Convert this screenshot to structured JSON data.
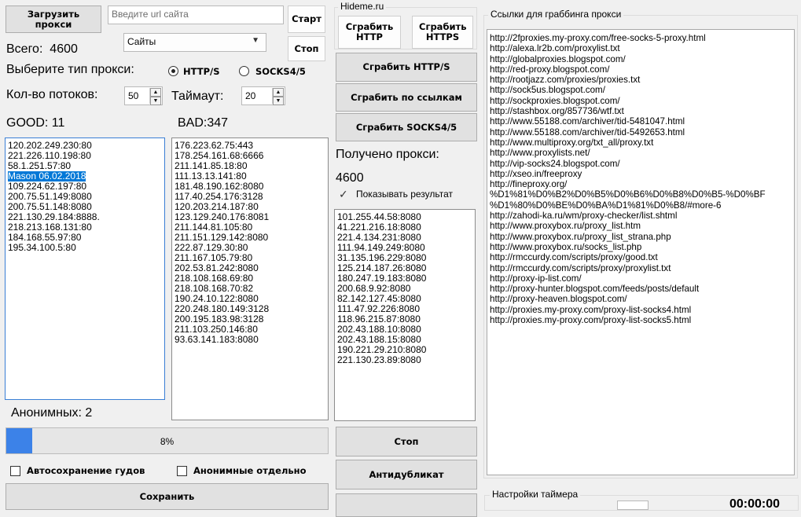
{
  "toolbar": {
    "load_proxy_label": "Загрузить прокси",
    "url_placeholder": "Введите url сайта",
    "start_label": "Старт",
    "stop_label": "Стоп",
    "source_select_value": "Сайты"
  },
  "stats": {
    "total_label": "Всего:",
    "total_value": "4600",
    "proxy_type_label": "Выберите тип прокси:",
    "type_http": "HTTP/S",
    "type_socks": "SOCKS4/5",
    "threads_label": "Кол-во потоков:",
    "threads_value": "50",
    "timeout_label": "Таймаут:",
    "timeout_value": "20"
  },
  "good": {
    "label": "GOOD: 11",
    "items": [
      "120.202.249.230:80",
      "221.226.110.198:80",
      "58.1.251.57:80",
      "Mason 06.02.2018",
      "109.224.62.197:80",
      "200.75.51.149:8080",
      "200.75.51.148:8080",
      "221.130.29.184:8888.",
      "218.213.168.131:80",
      "184.168.55.97:80",
      "195.34.100.5:80"
    ],
    "selected_index": 3
  },
  "bad": {
    "label": "BAD:347",
    "items": [
      "176.223.62.75:443",
      "178.254.161.68:6666",
      "211.141.85.18:80",
      "111.13.13.141:80",
      "181.48.190.162:8080",
      "117.40.254.176:3128",
      "120.203.214.187:80",
      "123.129.240.176:8081",
      "211.144.81.105:80",
      "211.151.129.142:8080",
      "222.87.129.30:80",
      "211.167.105.79:80",
      "202.53.81.242:8080",
      "218.108.168.69:80",
      "218.108.168.70:82",
      "190.24.10.122:8080",
      "220.248.180.149:3128",
      "200.195.183.98:3128",
      "211.103.250.146:80",
      "93.63.141.183:8080"
    ]
  },
  "anon": {
    "label": "Анонимных: 2"
  },
  "progress": {
    "value": 8,
    "text": "8%"
  },
  "options": {
    "autosave_label": "Автосохранение гудов",
    "anon_separate_label": "Анонимные отдельно",
    "save_label": "Сохранить"
  },
  "hideme": {
    "group_title": "Hideme.ru",
    "grab_http": "Сграбить HTTP",
    "grab_https": "Сграбить HTTPS"
  },
  "grab": {
    "grab_http_s": "Сграбить HTTP/S",
    "grab_by_links": "Сграбить по ссылкам",
    "grab_socks": "Сграбить SOCKS4/5",
    "received_label": "Получено прокси:",
    "received_value": "4600",
    "show_result_label": "Показывать результат",
    "show_result_checked": true,
    "results": [
      "101.255.44.58:8080",
      "41.221.216.18:8080",
      "221.4.134.231:8080",
      "111.94.149.249:8080",
      "31.135.196.229:8080",
      "125.214.187.26:8080",
      "180.247.19.183:8080",
      "200.68.9.92:8080",
      "82.142.127.45:8080",
      "111.47.92.226:8080",
      "118.96.215.87:8080",
      "202.43.188.10:8080",
      "202.43.188.15:8080",
      "190.221.29.210:8080",
      "221.130.23.89:8080"
    ],
    "stop_label": "Стоп",
    "antidup_label": "Антидубликат"
  },
  "links_panel": {
    "group_title": "Ссылки для граббинга прокси",
    "links": [
      "http://2fproxies.my-proxy.com/free-socks-5-proxy.html",
      "http://alexa.lr2b.com/proxylist.txt",
      "http://globalproxies.blogspot.com/",
      "http://red-proxy.blogspot.com/",
      "http://rootjazz.com/proxies/proxies.txt",
      "http://sock5us.blogspot.com/",
      "http://sockproxies.blogspot.com/",
      "http://stashbox.org/857736/wtf.txt",
      "http://www.55188.com/archiver/tid-5481047.html",
      "http://www.55188.com/archiver/tid-5492653.html",
      "http://www.multiproxy.org/txt_all/proxy.txt",
      "http://www.proxylists.net/",
      "http://vip-socks24.blogspot.com/",
      "http://xseo.in/freeproxy",
      "http://fineproxy.org/",
      "%D1%81%D0%B2%D0%B5%D0%B6%D0%B8%D0%B5-%D0%BF",
      "%D1%80%D0%BE%D0%BA%D1%81%D0%B8/#more-6",
      "http://zahodi-ka.ru/wm/proxy-checker/list.shtml",
      "http://www.proxybox.ru/proxy_list.htm",
      "http://www.proxybox.ru/proxy_list_strana.php",
      "http://www.proxybox.ru/socks_list.php",
      "http://rmccurdy.com/scripts/proxy/good.txt",
      "http://rmccurdy.com/scripts/proxy/proxylist.txt",
      "http://proxy-ip-list.com/",
      "http://proxy-hunter.blogspot.com/feeds/posts/default",
      "http://proxy-heaven.blogspot.com/",
      "http://proxies.my-proxy.com/proxy-list-socks4.html",
      "http://proxies.my-proxy.com/proxy-list-socks5.html"
    ]
  },
  "timer": {
    "group_title": "Настройки таймера",
    "time_value": "00:00:00"
  },
  "colors": {
    "selection": "#0078d7",
    "progress_fill": "#3c82e8"
  }
}
